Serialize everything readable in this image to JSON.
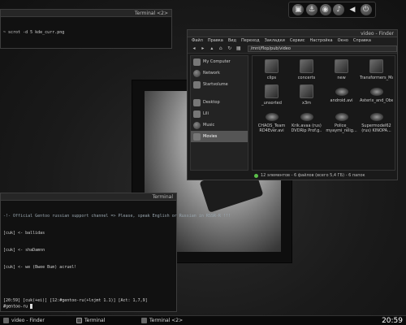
{
  "dock": {
    "icons": [
      "tv-icon",
      "anchor-icon",
      "firefox-icon",
      "music-icon",
      "arrow-icon",
      "power-icon"
    ]
  },
  "term_top": {
    "title": "Terminal <2>",
    "lines": [
      "~ scrot -d 5 kde_curr.png"
    ]
  },
  "file_manager": {
    "title": "video - Finder",
    "menu": [
      "Файл",
      "Правка",
      "Вид",
      "Переход",
      "Закладки",
      "Сервис",
      "Настройка",
      "Окно",
      "Справка"
    ],
    "path": "/mnt/flop/pub/video",
    "sidebar": [
      {
        "label": "My Computer"
      },
      {
        "label": "Network"
      },
      {
        "label": "Startvolume"
      },
      {
        "label": "Desktop"
      },
      {
        "label": "Lili"
      },
      {
        "label": "Music"
      },
      {
        "label": "Movies",
        "selected": true
      }
    ],
    "files": [
      {
        "name": "clips",
        "kind": "folder"
      },
      {
        "name": "concerts",
        "kind": "folder"
      },
      {
        "name": "new",
        "kind": "folder"
      },
      {
        "name": "Transformers_Masterforce_I...",
        "kind": "folder"
      },
      {
        "name": "_unsorted",
        "kind": "folder"
      },
      {
        "name": "x3m",
        "kind": "folder"
      },
      {
        "name": "android.avi",
        "kind": "disc"
      },
      {
        "name": "Asterix_and_Obelix_House...",
        "kind": "disc"
      },
      {
        "name": "CHAOS_Team RD4Ever.avi",
        "kind": "disc"
      },
      {
        "name": "Krik.avaa (rus) DVDRip Prof.g..",
        "kind": "disc"
      },
      {
        "name": "Police_ myaymi_relig...",
        "kind": "disc"
      },
      {
        "name": "Supermodel62 (rus) KINOPA...",
        "kind": "disc"
      }
    ],
    "status": "12 элементов - 6 файлов (всего 5,4 ГБ) - 6 папок"
  },
  "term_main": {
    "title": "Terminal",
    "lines": [
      "-!- Official Gentoo russian support channel => Please, speak English or Russian in RSSR-R !!!",
      "[cuk] <- ballidas",
      "[cuk] <- shaDamnn",
      "[cuk] <- we (Bwee Bum) acruel!"
    ],
    "status": "[20:59] [cuk(+ei)] [12:#gentoo-ru(+lnjmt 1.1)] [Act: 1,7,9]",
    "input": "#gentoo-ru"
  },
  "taskbar": {
    "tasks": [
      "video - Finder",
      "Terminal",
      "Terminal <2>"
    ],
    "clock": "20:59"
  }
}
